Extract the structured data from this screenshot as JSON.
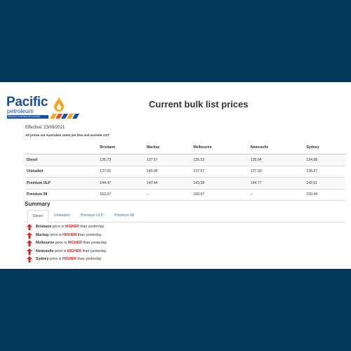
{
  "brand": {
    "name": "Pacific",
    "sub": "petroleum",
    "tagline": "PROUDLY AUSTRALIAN OWNED"
  },
  "page_title": "Current bulk list prices",
  "effective": "Effective: 23/09/2021",
  "note": "All prices are Australian cents per litre and exclude GST",
  "table": {
    "columns": [
      "",
      "Brisbane",
      "Mackay",
      "Melbourne",
      "Newcastle",
      "Sydney"
    ],
    "rows": [
      {
        "fuel": "Diesel",
        "values": [
          "136.73",
          "137.57",
          "135.53",
          "136.94",
          "134.98"
        ]
      },
      {
        "fuel": "Unleaded",
        "values": [
          "137.61",
          "140.08",
          "137.67",
          "137.03",
          "136.87"
        ]
      },
      {
        "fuel": "Premium ULP",
        "values": [
          "144.47",
          "147.44",
          "143.58",
          "144.77",
          "143.61"
        ]
      },
      {
        "fuel": "Premium 98",
        "values": [
          "152.57",
          "–",
          "150.67",
          "–",
          "150.44"
        ]
      }
    ]
  },
  "summary": {
    "title": "Summary",
    "tabs": [
      "Diesel",
      "Unleaded",
      "Premium ULP",
      "Premium 98"
    ],
    "active_tab": "Diesel",
    "items": [
      {
        "city": "Brisbane",
        "pre": " price is ",
        "word": "HIGHER",
        "post": " than yesterday"
      },
      {
        "city": "Mackay",
        "pre": " price is ",
        "word": "HIGHER",
        "post": " than yesterday"
      },
      {
        "city": "Melbourne",
        "pre": " price is ",
        "word": "HIGHER",
        "post": " than yesterday"
      },
      {
        "city": "Newcastle",
        "pre": " price is ",
        "word": "HIGHER",
        "post": " than yesterday"
      },
      {
        "city": "Sydney",
        "pre": " price is ",
        "word": "HIGHER",
        "post": " than yesterday"
      }
    ],
    "arrow_icon": "arrow-up-icon",
    "higher_color": "#d9251c"
  },
  "colors": {
    "band": "#04395b",
    "brand_blue": "#1a4fa3",
    "brand_orange": "#f5a623",
    "link": "#337ab7"
  }
}
